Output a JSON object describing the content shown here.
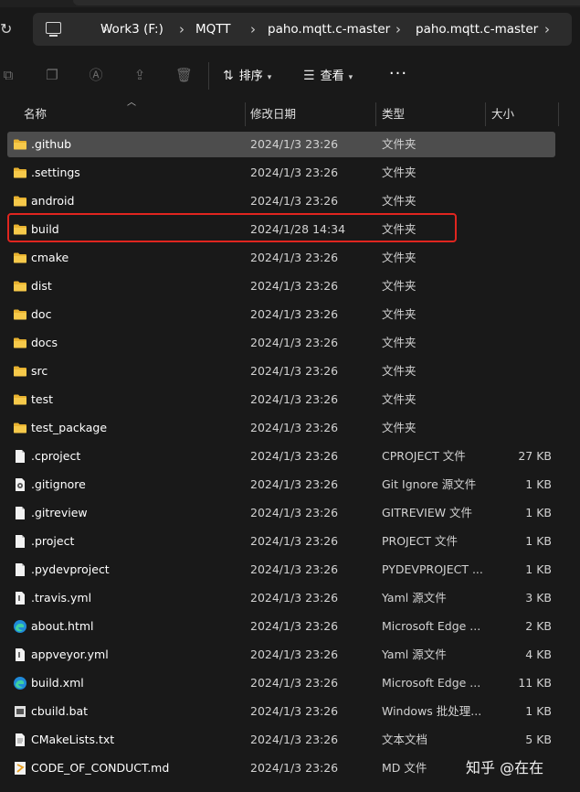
{
  "breadcrumb": [
    "Work3 (F:)",
    "MQTT",
    "paho.mqtt.c-master",
    "paho.mqtt.c-master"
  ],
  "toolbar": {
    "sort_label": "排序",
    "view_label": "查看",
    "more_label": "···"
  },
  "columns": {
    "name": "名称",
    "date": "修改日期",
    "type": "类型",
    "size": "大小"
  },
  "colors": {
    "folder": "#f4c542",
    "selected_row": "#4d4d4d",
    "highlight_box": "#e0251f",
    "background": "#191919"
  },
  "files": [
    {
      "name": ".github",
      "date": "2024/1/3 23:26",
      "type": "文件夹",
      "size": "",
      "icon": "folder-icon",
      "selected": true
    },
    {
      "name": ".settings",
      "date": "2024/1/3 23:26",
      "type": "文件夹",
      "size": "",
      "icon": "folder-icon"
    },
    {
      "name": "android",
      "date": "2024/1/3 23:26",
      "type": "文件夹",
      "size": "",
      "icon": "folder-icon"
    },
    {
      "name": "build",
      "date": "2024/1/28 14:34",
      "type": "文件夹",
      "size": "",
      "icon": "folder-icon",
      "highlighted": true
    },
    {
      "name": "cmake",
      "date": "2024/1/3 23:26",
      "type": "文件夹",
      "size": "",
      "icon": "folder-icon"
    },
    {
      "name": "dist",
      "date": "2024/1/3 23:26",
      "type": "文件夹",
      "size": "",
      "icon": "folder-icon"
    },
    {
      "name": "doc",
      "date": "2024/1/3 23:26",
      "type": "文件夹",
      "size": "",
      "icon": "folder-icon"
    },
    {
      "name": "docs",
      "date": "2024/1/3 23:26",
      "type": "文件夹",
      "size": "",
      "icon": "folder-icon"
    },
    {
      "name": "src",
      "date": "2024/1/3 23:26",
      "type": "文件夹",
      "size": "",
      "icon": "folder-icon"
    },
    {
      "name": "test",
      "date": "2024/1/3 23:26",
      "type": "文件夹",
      "size": "",
      "icon": "folder-icon"
    },
    {
      "name": "test_package",
      "date": "2024/1/3 23:26",
      "type": "文件夹",
      "size": "",
      "icon": "folder-icon"
    },
    {
      "name": ".cproject",
      "date": "2024/1/3 23:26",
      "type": "CPROJECT 文件",
      "size": "27 KB",
      "icon": "file-icon"
    },
    {
      "name": ".gitignore",
      "date": "2024/1/3 23:26",
      "type": "Git Ignore 源文件",
      "size": "1 KB",
      "icon": "gear-file-icon"
    },
    {
      "name": ".gitreview",
      "date": "2024/1/3 23:26",
      "type": "GITREVIEW 文件",
      "size": "1 KB",
      "icon": "file-icon"
    },
    {
      "name": ".project",
      "date": "2024/1/3 23:26",
      "type": "PROJECT 文件",
      "size": "1 KB",
      "icon": "file-icon"
    },
    {
      "name": ".pydevproject",
      "date": "2024/1/3 23:26",
      "type": "PYDEVPROJECT ...",
      "size": "1 KB",
      "icon": "file-icon"
    },
    {
      "name": ".travis.yml",
      "date": "2024/1/3 23:26",
      "type": "Yaml 源文件",
      "size": "3 KB",
      "icon": "yaml-file-icon"
    },
    {
      "name": "about.html",
      "date": "2024/1/3 23:26",
      "type": "Microsoft Edge ...",
      "size": "2 KB",
      "icon": "edge-icon"
    },
    {
      "name": "appveyor.yml",
      "date": "2024/1/3 23:26",
      "type": "Yaml 源文件",
      "size": "4 KB",
      "icon": "yaml-file-icon"
    },
    {
      "name": "build.xml",
      "date": "2024/1/3 23:26",
      "type": "Microsoft Edge ...",
      "size": "11 KB",
      "icon": "edge-icon"
    },
    {
      "name": "cbuild.bat",
      "date": "2024/1/3 23:26",
      "type": "Windows 批处理...",
      "size": "1 KB",
      "icon": "batch-file-icon"
    },
    {
      "name": "CMakeLists.txt",
      "date": "2024/1/3 23:26",
      "type": "文本文档",
      "size": "5 KB",
      "icon": "text-file-icon"
    },
    {
      "name": "CODE_OF_CONDUCT.md",
      "date": "2024/1/3 23:26",
      "type": "MD 文件",
      "size": "",
      "icon": "markdown-file-icon"
    }
  ],
  "watermark": "知乎 @在在"
}
